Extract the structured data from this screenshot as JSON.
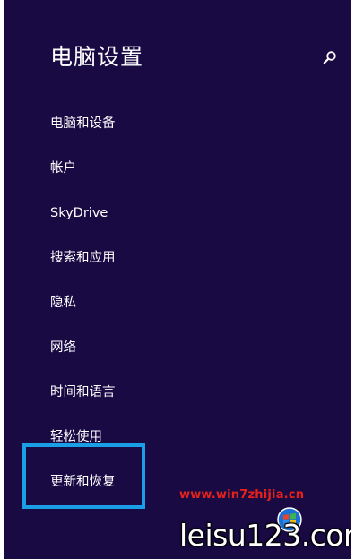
{
  "header": {
    "title": "电脑设置",
    "search_icon": "search-icon"
  },
  "nav": {
    "items": [
      {
        "label": "电脑和设备"
      },
      {
        "label": "帐户"
      },
      {
        "label": "SkyDrive"
      },
      {
        "label": "搜索和应用"
      },
      {
        "label": "隐私"
      },
      {
        "label": "网络"
      },
      {
        "label": "时间和语言"
      },
      {
        "label": "轻松使用"
      },
      {
        "label": "更新和恢复"
      }
    ],
    "highlighted_item": "更新和恢复"
  },
  "watermark": {
    "url": "www.win7zhijia.cn",
    "logo_text": "leisu123.com"
  },
  "colors": {
    "background": "#190a44",
    "text": "#ffffff",
    "highlight_border": "#1a9ee6",
    "watermark_url": "#e8201a"
  }
}
